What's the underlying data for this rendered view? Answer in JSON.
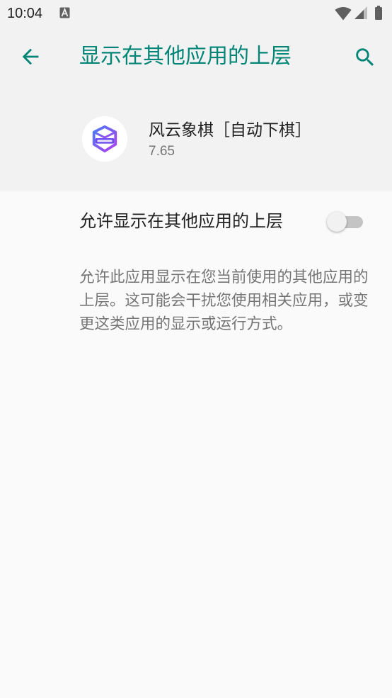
{
  "status_bar": {
    "time": "10:04",
    "notification_icon": "text-a-notification-icon",
    "system_icons": [
      "wifi-icon",
      "cell-signal-icon",
      "battery-icon"
    ]
  },
  "app_bar": {
    "title": "显示在其他应用的上层",
    "back_icon": "arrow-back-icon",
    "search_icon": "search-icon"
  },
  "app_info": {
    "name": "风云象棋［自动下棋］",
    "version": "7.65",
    "icon": "app-launcher-icon"
  },
  "setting": {
    "label": "允许显示在其他应用的上层",
    "enabled": false,
    "description": "允许此应用显示在您当前使用的其他应用的上层。这可能会干扰您使用相关应用，或变更这类应用的显示或运行方式。"
  },
  "colors": {
    "accent": "#008577",
    "header_background": "#f2f2f2",
    "body_background": "#fafafa",
    "primary_text": "#212121",
    "secondary_text": "#757575"
  }
}
